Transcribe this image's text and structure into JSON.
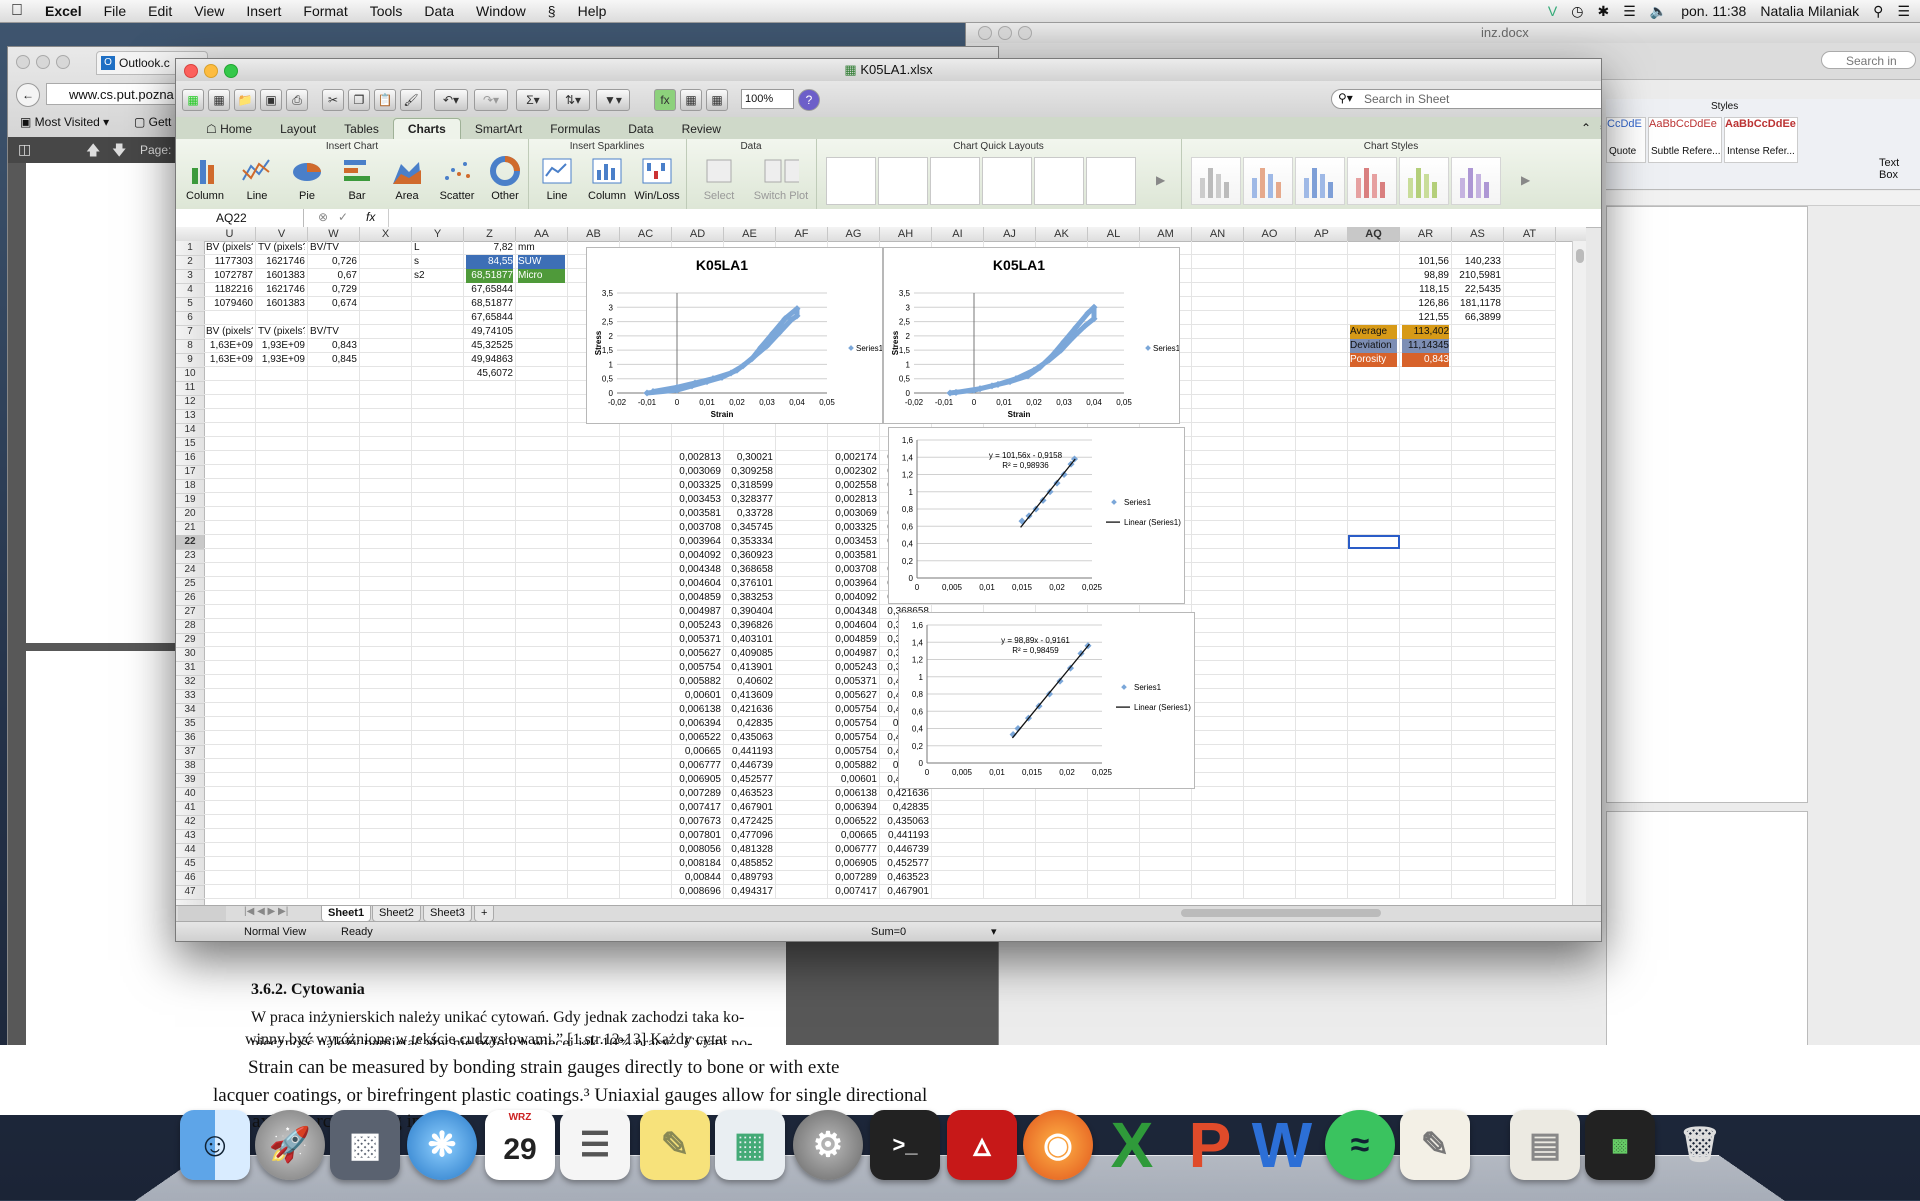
{
  "menubar": {
    "apple": "",
    "app_name": "Excel",
    "items": [
      "File",
      "Edit",
      "View",
      "Insert",
      "Format",
      "Tools",
      "Data",
      "Window",
      "Help"
    ],
    "clock": "pon. 11:38",
    "user": "Natalia Milaniak"
  },
  "firefox": {
    "tab": "Outlook.c",
    "url": "www.cs.put.pozna",
    "bookmark1": "Most Visited",
    "bookmark2": "Gett",
    "page_label": "Page:"
  },
  "word": {
    "title": "inz.docx",
    "search_placeholder": "Search in",
    "styles_label": "Styles",
    "style_quote": "Quote",
    "style_subtle": "Subtle Refere...",
    "style_intense": "Intense Refer...",
    "style_sample": "AaBbCcDdEe",
    "text_box": "Text Box",
    "heading": "3.6.2. Cytowania",
    "para1": "W praca inżynierskich należy unikać cytowań. Gdy jednak zachodzi taka ko-",
    "para2": "nieczność należy pamiętać aby nie było ich więcej jak 10% pracy. „Cytaty po-",
    "para3": "winny być wyróżnione w tekście cudzysłowami.” [1.str.12-13] Każdy cytat",
    "para4": "Strain can be measured by bonding strain gauges directly to bone or with exte",
    "para5": "lacquer coatings, or birefringent plastic coatings.³ Uniaxial gauges allow for single directional",
    "para6": "as         w       axi      rcus        rc        po      di           a      g           ip      ins"
  },
  "excel": {
    "title": "K05LA1.xlsx",
    "zoom": "100%",
    "search_placeholder": "Search in Sheet",
    "tabs": [
      "Home",
      "Layout",
      "Tables",
      "Charts",
      "SmartArt",
      "Formulas",
      "Data",
      "Review"
    ],
    "active_tab": "Charts",
    "groups": {
      "insert_chart": "Insert Chart",
      "insert_sparklines": "Insert Sparklines",
      "data": "Data",
      "quick_layouts": "Chart Quick Layouts",
      "chart_styles": "Chart Styles"
    },
    "chart_buttons": [
      "Column",
      "Line",
      "Pie",
      "Bar",
      "Area",
      "Scatter",
      "Other"
    ],
    "spark_buttons": [
      "Line",
      "Column",
      "Win/Loss"
    ],
    "data_buttons": [
      "Select",
      "Switch Plot"
    ],
    "name_box": "AQ22",
    "fx": "fx",
    "columns": [
      "U",
      "V",
      "W",
      "X",
      "Y",
      "Z",
      "AA",
      "AB",
      "AC",
      "AD",
      "AE",
      "AF",
      "AG",
      "AH",
      "AI",
      "AJ",
      "AK",
      "AL",
      "AM",
      "AN",
      "AO",
      "AP",
      "AQ",
      "AR",
      "AS",
      "AT"
    ],
    "selected_col": "AQ",
    "selected_row": "22",
    "rows": [
      "1",
      "2",
      "3",
      "4",
      "5",
      "6",
      "7",
      "8",
      "9",
      "10",
      "11",
      "12",
      "13",
      "14",
      "15",
      "16",
      "17",
      "18",
      "19",
      "20",
      "21",
      "22",
      "23",
      "24",
      "25",
      "26",
      "27",
      "28",
      "29",
      "30",
      "31",
      "32",
      "33",
      "34",
      "35",
      "36",
      "37",
      "38",
      "39",
      "40",
      "41",
      "42",
      "43",
      "44",
      "45",
      "46",
      "47"
    ],
    "top_cells": {
      "u1": "BV (pixels?",
      "v1": "TV (pixels?",
      "w1": "BV/TV",
      "u2": "1177303",
      "v2": "1621746",
      "w2": "0,726",
      "u3": "1072787",
      "v3": "1601383",
      "w3": "0,67",
      "u4": "1182216",
      "v4": "1621746",
      "w4": "0,729",
      "u5": "1079460",
      "v5": "1601383",
      "w5": "0,674",
      "u7": "BV (pixels?",
      "v7": "TV (pixels?",
      "w7": "BV/TV",
      "u8": "1,63E+09",
      "v8": "1,93E+09",
      "w8": "0,843",
      "u9": "1,63E+09",
      "v9": "1,93E+09",
      "w9": "0,845",
      "y1": "L",
      "y2": "s",
      "y3": "s2",
      "z1": "7,82",
      "aa1": "mm",
      "z2": "84,55",
      "aa2": "SUW",
      "z3": "68,51877",
      "aa3": "Micro",
      "z4": "67,65844",
      "z5": "68,51877",
      "z6": "67,65844",
      "z7": "49,74105",
      "z8": "45,32525",
      "z9": "49,94863",
      "z10": "45,6072"
    },
    "right_cells": {
      "ar": [
        "101,56",
        "98,89",
        "118,15",
        "126,86",
        "121,55"
      ],
      "as": [
        "140,233",
        "210,5981",
        "22,5435",
        "181,1178",
        "66,3899"
      ],
      "average_label": "Average",
      "average": "113,402",
      "deviation_label": "Deviation",
      "deviation": "11,14345",
      "porosity_label": "Porosity",
      "porosity": "0,843"
    },
    "ad_col": [
      "0,002813",
      "0,003069",
      "0,003325",
      "0,003453",
      "0,003581",
      "0,003708",
      "0,003964",
      "0,004092",
      "0,004348",
      "0,004604",
      "0,004859",
      "0,004987",
      "0,005243",
      "0,005371",
      "0,005627",
      "0,005754",
      "0,005882",
      "0,00601",
      "0,006138",
      "0,006394",
      "0,006522",
      "0,00665",
      "0,006777",
      "0,006905",
      "0,007289",
      "0,007417",
      "0,007673",
      "0,007801",
      "0,008056",
      "0,008184",
      "0,00844",
      "0,008696"
    ],
    "ae_col": [
      "0,30021",
      "0,309258",
      "0,318599",
      "0,328377",
      "0,33728",
      "0,345745",
      "0,353334",
      "0,360923",
      "0,368658",
      "0,376101",
      "0,383253",
      "0,390404",
      "0,396826",
      "0,403101",
      "0,409085",
      "0,413901",
      "0,40602",
      "0,413609",
      "0,421636",
      "0,42835",
      "0,435063",
      "0,441193",
      "0,446739",
      "0,452577",
      "0,463523",
      "0,467901",
      "0,472425",
      "0,477096",
      "0,481328",
      "0,485852",
      "0,489793",
      "0,494317"
    ],
    "ag_col": [
      "0,002174",
      "0,002302",
      "0,002558",
      "0,002813",
      "0,003069",
      "0,003325",
      "0,003453",
      "0,003581",
      "0,003708",
      "0,003964",
      "0,004092",
      "0,004348",
      "0,004604",
      "0,004859",
      "0,004987",
      "0,005243",
      "0,005371",
      "0,005627",
      "0,005754",
      "0,005754",
      "0,005754",
      "0,005754",
      "0,005882",
      "0,00601",
      "0,006138",
      "0,006394",
      "0,006522",
      "0,00665",
      "0,006777",
      "0,006905",
      "0,007289",
      "0,007417"
    ],
    "ah_col": [
      "0,270725",
      "0,280507",
      "0,290577",
      "0,30021",
      "0,309258",
      "0,318599",
      "0,328377",
      "0,33728",
      "0,345745",
      "0,353334",
      "0,360923",
      "0,368658",
      "0,376101",
      "0,383253",
      "0,390404",
      "0,396826",
      "0,403101",
      "0,409085",
      "0,413901",
      "0,41069",
      "0,407188",
      "0,403977",
      "0,40602",
      "0,413609",
      "0,421636",
      "0,42835",
      "0,435063",
      "0,441193",
      "0,446739",
      "0,452577",
      "0,463523",
      "0,467901"
    ],
    "sheets": [
      "Sheet1",
      "Sheet2",
      "Sheet3"
    ],
    "active_sheet": "Sheet1",
    "status": {
      "view": "Normal View",
      "ready": "Ready",
      "sum": "Sum=0"
    }
  },
  "chart_data": [
    {
      "type": "scatter",
      "title": "K05LA1",
      "xlabel": "Strain",
      "ylabel": "Stress",
      "xlim": [
        -0.02,
        0.05
      ],
      "ylim": [
        0,
        3.5
      ],
      "xticks": [
        "-0,02",
        "-0,01",
        "0",
        "0,01",
        "0,02",
        "0,03",
        "0,04",
        "0,05"
      ],
      "yticks": [
        "0",
        "0,5",
        "1",
        "1,5",
        "2",
        "2,5",
        "3",
        "3,5"
      ],
      "legend": "right",
      "color": "#7ba7d9",
      "series": [
        {
          "name": "Series1",
          "x": [
            -0.01,
            0.0,
            0.005,
            0.01,
            0.015,
            0.02,
            0.025,
            0.028,
            0.032,
            0.036,
            0.04,
            0.04,
            0.038,
            0.034,
            0.03,
            0.026,
            0.022,
            0.018,
            0.012,
            0.006,
            0.0,
            -0.008
          ],
          "y": [
            0,
            0.1,
            0.25,
            0.4,
            0.55,
            0.8,
            1.2,
            1.6,
            2.1,
            2.6,
            2.95,
            2.7,
            2.55,
            2.1,
            1.65,
            1.3,
            0.95,
            0.7,
            0.5,
            0.35,
            0.2,
            0.05
          ]
        }
      ]
    },
    {
      "type": "scatter",
      "title": "K05LA1",
      "xlabel": "Strain",
      "ylabel": "Stress",
      "xlim": [
        -0.02,
        0.05
      ],
      "ylim": [
        0,
        3.5
      ],
      "xticks": [
        "-0,02",
        "-0,01",
        "0",
        "0,01",
        "0,02",
        "0,03",
        "0,04",
        "0,05"
      ],
      "yticks": [
        "0",
        "0,5",
        "1",
        "1,5",
        "2",
        "2,5",
        "3",
        "3,5"
      ],
      "legend": "right",
      "color": "#7ba7d9",
      "series": [
        {
          "name": "Series1",
          "x": [
            -0.008,
            0.0,
            0.006,
            0.012,
            0.018,
            0.022,
            0.026,
            0.03,
            0.034,
            0.038,
            0.04,
            0.04,
            0.037,
            0.033,
            0.029,
            0.025,
            0.02,
            0.014,
            0.008,
            0.002,
            -0.006
          ],
          "y": [
            0,
            0.1,
            0.25,
            0.4,
            0.6,
            0.9,
            1.3,
            1.8,
            2.3,
            2.8,
            3.0,
            2.6,
            2.35,
            1.95,
            1.5,
            1.15,
            0.8,
            0.5,
            0.3,
            0.15,
            0.02
          ]
        }
      ]
    },
    {
      "type": "scatter",
      "title": "",
      "xlim": [
        0,
        0.025
      ],
      "ylim": [
        0,
        1.6
      ],
      "xticks": [
        "0",
        "0,005",
        "0,01",
        "0,015",
        "0,02",
        "0,025"
      ],
      "yticks": [
        "0",
        "0,2",
        "0,4",
        "0,6",
        "0,8",
        "1",
        "1,2",
        "1,4",
        "1,6"
      ],
      "equation": "y = 101,56x - 0,9158",
      "r2": "R² = 0,98936",
      "legend": "right",
      "legend_entries": [
        "Series1",
        "Linear (Series1)"
      ],
      "series": [
        {
          "name": "Series1",
          "x": [
            0.015,
            0.016,
            0.017,
            0.018,
            0.019,
            0.02,
            0.021,
            0.022,
            0.0225
          ],
          "y": [
            0.66,
            0.72,
            0.8,
            0.9,
            1.0,
            1.1,
            1.2,
            1.32,
            1.38
          ]
        }
      ],
      "trend": {
        "slope": 101.56,
        "intercept": -0.9158,
        "x": [
          0.0148,
          0.0226
        ]
      }
    },
    {
      "type": "scatter",
      "title": "",
      "xlim": [
        0,
        0.025
      ],
      "ylim": [
        0,
        1.6
      ],
      "xticks": [
        "0",
        "0,005",
        "0,01",
        "0,015",
        "0,02",
        "0,025"
      ],
      "yticks": [
        "0",
        "0,2",
        "0,4",
        "0,6",
        "0,8",
        "1",
        "1,2",
        "1,4",
        "1,6"
      ],
      "equation": "y = 98,89x - 0,9161",
      "r2": "R² = 0,98459",
      "legend": "right",
      "legend_entries": [
        "Series1",
        "Linear (Series1)"
      ],
      "series": [
        {
          "name": "Series1",
          "x": [
            0.0123,
            0.013,
            0.0145,
            0.016,
            0.0175,
            0.019,
            0.0205,
            0.022,
            0.023
          ],
          "y": [
            0.33,
            0.4,
            0.52,
            0.66,
            0.8,
            0.95,
            1.1,
            1.27,
            1.36
          ]
        }
      ],
      "trend": {
        "slope": 98.89,
        "intercept": -0.9161,
        "x": [
          0.0122,
          0.0232
        ]
      }
    }
  ],
  "dock": [
    "Finder",
    "Launchpad",
    "Photos",
    "Safari",
    "Calendar",
    "Reminders",
    "Stickies",
    "Preview",
    "System Preferences",
    "Terminal",
    "Acrobat",
    "Firefox",
    "Excel",
    "PowerPoint",
    "Word",
    "Spotify",
    "TextEdit",
    "Documents",
    "Activity Monitor",
    "Trash"
  ],
  "calendar": {
    "month": "WRZ",
    "day": "29"
  }
}
